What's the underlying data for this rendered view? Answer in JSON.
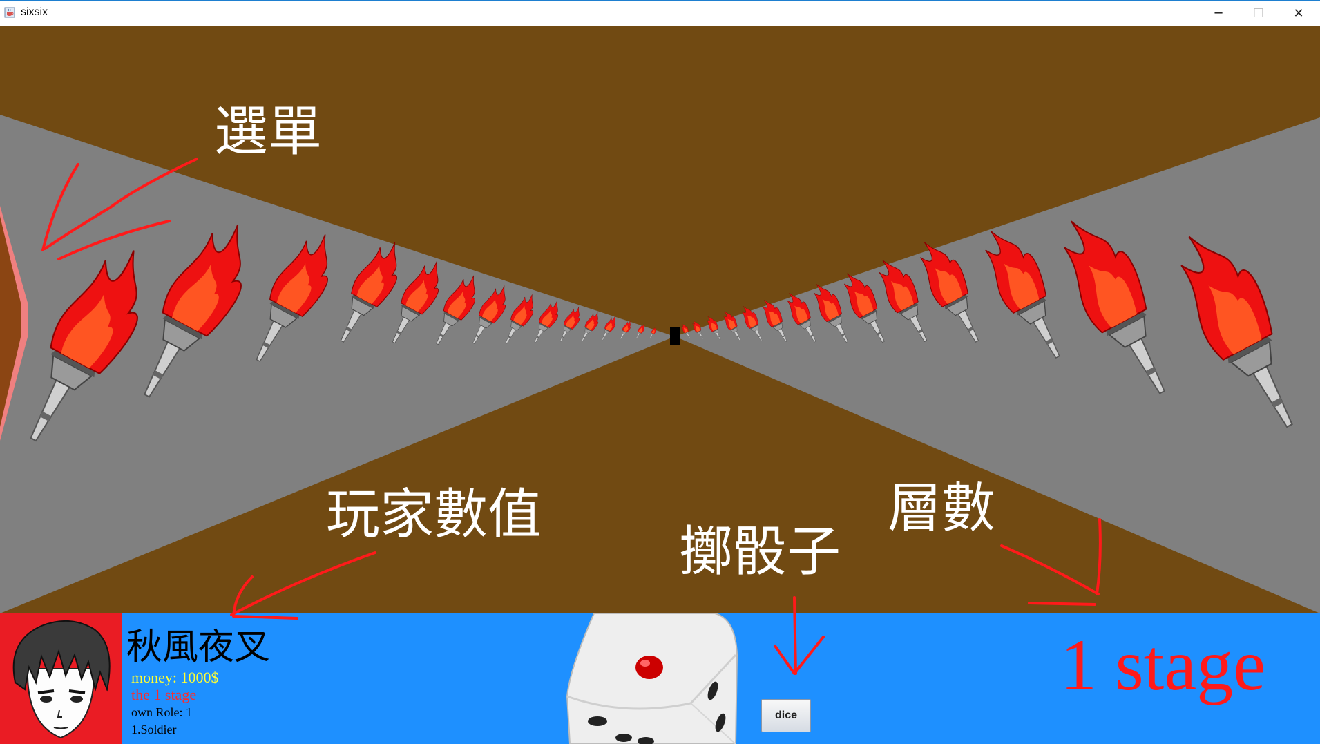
{
  "window": {
    "title": "sixsix",
    "minimize_glyph": "─",
    "maximize_glyph": "☐",
    "close_glyph": "✕",
    "icon": "java-cup-icon"
  },
  "scene": {
    "ceiling_color": "#714a12",
    "wall_color": "#808080",
    "floor_color": "#714a12",
    "decorations": "flaming-torch-icon"
  },
  "annotations": {
    "menu": "選單",
    "player_stats": "玩家數值",
    "roll_dice": "擲骰子",
    "floor_count": "層數",
    "ink_color": "#ff1a1a"
  },
  "player": {
    "name": "秋風夜叉",
    "money": "money: 1000$",
    "stage": "the 1 stage",
    "own_role": "own Role: 1",
    "role_name": "1.Soldier"
  },
  "dice": {
    "button_label": "dice",
    "face_up": 1
  },
  "stage": {
    "label": "1 stage"
  },
  "colors": {
    "hud_bg": "#1e90ff",
    "portrait_bg": "#ea1c24",
    "money_text": "#ffff33",
    "stage_text": "#ff2a2a"
  }
}
